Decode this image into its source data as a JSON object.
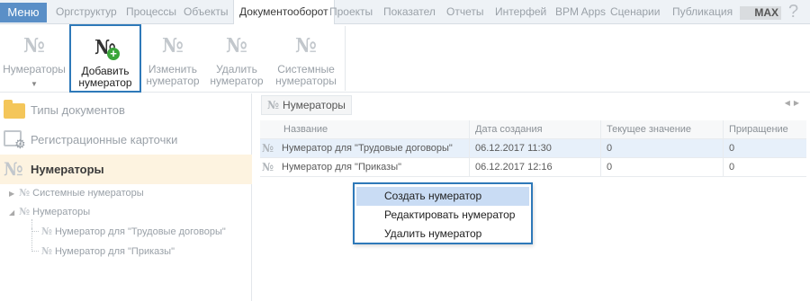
{
  "menu": {
    "label": "Меню"
  },
  "tabs": [
    {
      "label": "Оргструктур"
    },
    {
      "label": "Процессы"
    },
    {
      "label": "Объекты"
    },
    {
      "label": "Документооборот",
      "active": true
    },
    {
      "label": "Проекты"
    },
    {
      "label": "Показател"
    },
    {
      "label": "Отчеты"
    },
    {
      "label": "Интерфей"
    },
    {
      "label": "BPM Apps"
    },
    {
      "label": "Сценарии"
    },
    {
      "label": "Публикация"
    }
  ],
  "max_badge": "MAX",
  "help_icon": "?",
  "ribbon": {
    "numerators": {
      "label": "Нумераторы",
      "icon": "numero-icon"
    },
    "add": {
      "line1": "Добавить",
      "line2": "нумератор",
      "icon": "numero-add-icon"
    },
    "edit": {
      "line1": "Изменить",
      "line2": "нумератор",
      "icon": "numero-edit-icon"
    },
    "delete": {
      "line1": "Удалить",
      "line2": "нумератор",
      "icon": "numero-delete-icon"
    },
    "system": {
      "line1": "Системные",
      "line2": "нумераторы",
      "icon": "numero-system-icon"
    }
  },
  "nav": {
    "doc_types": "Типы документов",
    "reg_cards": "Регистрационные карточки",
    "numerators": "Нумераторы"
  },
  "tree": {
    "system": "Системные нумераторы",
    "numerators": "Нумераторы",
    "child1": "Нумератор для \"Трудовые договоры\"",
    "child2": "Нумератор для \"Приказы\""
  },
  "content_tab": "Нумераторы",
  "grid": {
    "columns": [
      "Название",
      "Дата создания",
      "Текущее значение",
      "Приращение"
    ],
    "rows": [
      {
        "name": "Нумератор для \"Трудовые договоры\"",
        "date": "06.12.2017 11:30",
        "current": "0",
        "increment": "0"
      },
      {
        "name": "Нумератор для \"Приказы\"",
        "date": "06.12.2017 12:16",
        "current": "0",
        "increment": "0"
      }
    ]
  },
  "context_menu": {
    "create": "Создать нумератор",
    "edit": "Редактировать нумератор",
    "delete": "Удалить нумератор"
  },
  "colors": {
    "accent": "#2e79b9",
    "menu_button": "#5a8fc7",
    "selected_nav": "#fdf3e0",
    "hover_item": "#c9dcf4"
  }
}
